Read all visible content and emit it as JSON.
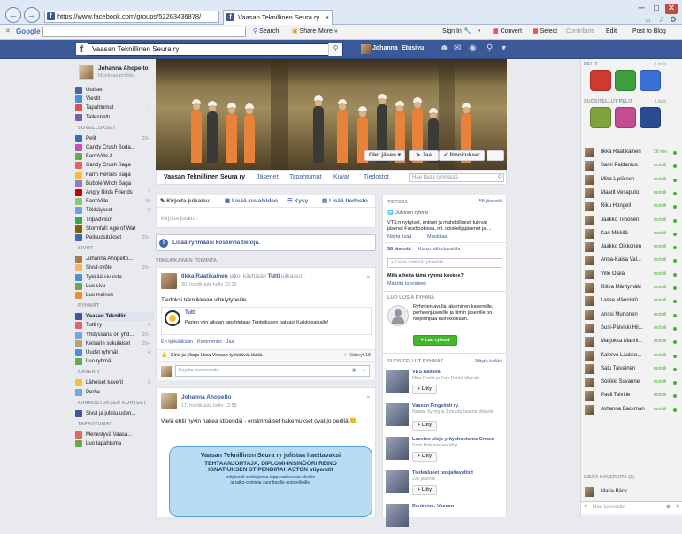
{
  "browser": {
    "url": "https://www.facebook.com/groups/52263436878/",
    "tab_title": "Vaasan Teknillinen Seura ry",
    "tab_close": "×",
    "window_buttons": [
      "─",
      "□",
      "✕"
    ]
  },
  "google_toolbar": {
    "close": "✕",
    "logo": "Google",
    "search_label": "Search",
    "share_label": "Share",
    "more_label": "More »",
    "signin_label": "Sign In",
    "convert_label": "Convert",
    "select_label": "Select",
    "contribute_label": "Contribute",
    "edit_label": "Edit",
    "post_label": "Post to Blog"
  },
  "fb_header": {
    "search_value": "Vaasan Teknillinen Seura ry",
    "user_name": "Johanna",
    "home_label": "Etusivu"
  },
  "left": {
    "profile_name": "Johanna Ahopelto",
    "profile_edit": "Muokkaa profiilia",
    "top_items": [
      {
        "label": "Uutiset",
        "count": "",
        "color": "#4267b2"
      },
      {
        "label": "Viestit",
        "count": "",
        "color": "#4a90d9"
      },
      {
        "label": "Tapahtumat",
        "count": "1",
        "color": "#d9534f"
      },
      {
        "label": "Tallennettu",
        "count": "",
        "color": "#7b5ea7"
      }
    ],
    "apps_title": "SOVELLUKSET",
    "apps": [
      {
        "label": "Pelit",
        "count": "20+",
        "color": "#2f6fbd"
      },
      {
        "label": "Candy Crush Soda...",
        "count": "",
        "color": "#c94bbd"
      },
      {
        "label": "FarmVille 2",
        "count": "",
        "color": "#6aa84f"
      },
      {
        "label": "Candy Crush Saga",
        "count": "",
        "color": "#e06666"
      },
      {
        "label": "Farm Heroes Saga",
        "count": "",
        "color": "#f1c232"
      },
      {
        "label": "Bubble Witch Saga",
        "count": "",
        "color": "#8e7cc3"
      },
      {
        "label": "Angry Birds Friends",
        "count": "7",
        "color": "#cc0000"
      },
      {
        "label": "FarmVille",
        "count": "16",
        "color": "#93c47d"
      },
      {
        "label": "Tökkäykset",
        "count": "2",
        "color": "#6d9eeb"
      },
      {
        "label": "TripAdvisor",
        "count": "",
        "color": "#34a853"
      },
      {
        "label": "Stormfall: Age of War",
        "count": "",
        "color": "#7f6000"
      },
      {
        "label": "Pelisuositukset",
        "count": "20+",
        "color": "#4267b2"
      }
    ],
    "pages_title": "SIVUT",
    "pages": [
      {
        "label": "Johanna Ahopelto...",
        "count": "",
        "color": "#a67c52"
      },
      {
        "label": "Sivut-syöte",
        "count": "20+",
        "color": "#f6b26b"
      },
      {
        "label": "Tykkää sivuista",
        "count": "",
        "color": "#4a90d9"
      },
      {
        "label": "Luo sivu",
        "count": "",
        "color": "#6aa84f"
      },
      {
        "label": "Luo mainos",
        "count": "",
        "color": "#e69138"
      }
    ],
    "groups_title": "RYHMÄT",
    "groups": [
      {
        "label": "Vaasan Teknillin...",
        "count": "",
        "color": "#3b5998"
      },
      {
        "label": "Tutti ry",
        "count": "4",
        "color": "#e06666"
      },
      {
        "label": "Yhdyssana on yhd...",
        "count": "20+",
        "color": "#6fa8dc"
      },
      {
        "label": "Keisarin sukulaiset",
        "count": "20+",
        "color": "#b6a36f"
      },
      {
        "label": "Uudet ryhmät",
        "count": "4",
        "color": "#4a90d9"
      },
      {
        "label": "Luo ryhmä",
        "count": "",
        "color": "#6aa84f"
      }
    ],
    "friends_title": "KAVERIT",
    "friends": [
      {
        "label": "Läheiset kaverit",
        "count": "3",
        "color": "#f1c232"
      },
      {
        "label": "Perhe",
        "count": "",
        "color": "#6fa8dc"
      }
    ],
    "interests_title": "KIINNOSTUKSEN KOHTEET",
    "interests": [
      {
        "label": "Sivut ja julkisuuden...",
        "count": "",
        "color": "#3b5998"
      }
    ],
    "events_title": "TAPAHTUMAT",
    "events": [
      {
        "label": "Menestyvä Vaasa...",
        "count": "",
        "color": "#e06666"
      },
      {
        "label": "Luo tapahtuma",
        "count": "",
        "color": "#6aa84f"
      }
    ]
  },
  "cover": {
    "joined_btn": "Olet jäsen",
    "share_btn": "Jaa",
    "notif_btn": "Ilmoitukset",
    "more_btn": "..."
  },
  "group_nav": {
    "name": "Vaasan Teknillinen Seura ry",
    "members": "Jäsenet",
    "events": "Tapahtumat",
    "photos": "Kuvat",
    "files": "Tiedostot",
    "search_placeholder": "Hae tästä ryhmästä"
  },
  "composer": {
    "write_tab": "Kirjoita julkaisu",
    "photo_tab": "Lisää kuva/video",
    "poll_tab": "Kysy",
    "file_tab": "Lisää tiedosto",
    "placeholder": "Kirjoita jotain..."
  },
  "info_banner": "Lisää ryhmääsi koskevia tietoja.",
  "recent_title": "VIIMEAIKAINEN TOIMINTA",
  "post1": {
    "author": "Ilkka Raatikainen",
    "via": "jakoi käyttäjän",
    "via_target": "Tutti",
    "via_suffix": "julkaisun.",
    "time": "30. huhtikuuta kello 22:30",
    "text": "Tiedoksi tekniikkaan vihkiytyneille...",
    "shared_author": "Tutti",
    "shared_text": "Parien yön aikaan tapahtetaan Tepteikusen patsas! Kaikki paikalle!",
    "actions": "En tykkääkään · Kommentoi · Jaa",
    "likes": "Sinä ja Marja-Liisa Vessan tykkäävät tästä.",
    "seen": "✓ Nähnyt 18",
    "comment_placeholder": "Kirjoita kommentti..."
  },
  "post2": {
    "author": "Johanna Ahopelto",
    "time": "17. huhtikuuta kello 12:58",
    "text": "Vielä ehtii hyvin hakea stipendiä - ensimmäiset hakemukset ovat jo perillä 🙂",
    "poster_line1": "Vaasan Teknillinen Seura ry julistaa haettavaksi",
    "poster_line2": "TEHTAANJOHTAJA, DIPLOMI-INSINÖÖRI REINO",
    "poster_line3": "IGNATIUKSEN STIPENDIRAHASTON stipendit",
    "poster_line4": "erityisesti opintojensa loppuvaiheessa oleville",
    "poster_line5": "ja jatko-opintoja suorittaville opiskelijoille."
  },
  "sidebar": {
    "info_title": "TIETOJA",
    "members_link": "58 jäsentä",
    "privacy": "Julkinen ryhmä",
    "description": "VTS:n nykyiset, entiset ja mahdollisesti tulevat jäsenet Facebookissa, ml. opiskelijajäsenet ja ...",
    "show_more": "Näytä lisää",
    "muokkaa": "Muokkaa",
    "members_count": "58 jäsentä",
    "invite_email": "Kutsu sähköpostilla",
    "add_member_placeholder": "+ Lisää ihmisiä ryhmään",
    "tags_title": "Mitä aiheita tämä ryhmä koskee?",
    "tags_link": "Määritä tunnisteet",
    "create_title": "LUO UUSIA RYHMIÄ",
    "create_text": "Ryhmien avulla jakaminen kavereille, perheenjäsenille ja tiimin jäsenille on helpompaa kuin koskaan.",
    "create_btn": "+ Luo ryhmä",
    "suggested_title": "SUOSITELLUT RYHMÄT",
    "see_all": "Näytä kaikki",
    "suggested": [
      {
        "name": "VES Aallava",
        "desc": "Mika Pietilä ja Turo Rantä liittyivät",
        "btn": "+ Liity"
      },
      {
        "name": "Vaasan Pingviinit ry.",
        "desc": "Natalia Syring ja 2 muuta kaveria liittyivät",
        "btn": "+ Liity"
      },
      {
        "name": "Laovien aloja yrityshautomo Crewe",
        "desc": "Sami Heikkinenen liittyi",
        "btn": "+ Liity"
      },
      {
        "name": "Tiedealueet poujaltavaltiot",
        "desc": "220 jäsentä",
        "btn": "+ Liity"
      },
      {
        "name": "Puukkoo - Vaasan",
        "desc": "",
        "btn": ""
      }
    ]
  },
  "right": {
    "games_title": "PELIT",
    "games_more": "Lisää",
    "suggested_games_title": "SUOSITELLUT PELIT",
    "suggested_games_more": "Lisää",
    "games": [
      "#d03a2e",
      "#3e9e3b",
      "#3a6fd3",
      "#7ea33a",
      "#c34d91",
      "#2b4c93"
    ],
    "chat_title": "LISÄÄ KAVEREITA (3)",
    "chat_search": "Hae",
    "chat_search_placeholder": "Hae kavereita",
    "contacts": [
      {
        "name": "Ilkka Raatikainen",
        "status": "26 min"
      },
      {
        "name": "Sami Paldanius",
        "status": "mobiili"
      },
      {
        "name": "Mika Lipiäinen",
        "status": "mobiili"
      },
      {
        "name": "Maarit Vesaputo",
        "status": "mobiili"
      },
      {
        "name": "Riku Hongell",
        "status": "mobiili"
      },
      {
        "name": "Jaakko Tiihonen",
        "status": "mobiili"
      },
      {
        "name": "Kari Mikkilä",
        "status": "mobiili"
      },
      {
        "name": "Jaakko Oikkonen",
        "status": "mobiili"
      },
      {
        "name": "Anna-Kaisa Val...",
        "status": "mobiili"
      },
      {
        "name": "Ville Ojala",
        "status": "mobiili"
      },
      {
        "name": "Riitva Mäntymäki",
        "status": "mobiili"
      },
      {
        "name": "Lasse Männistö",
        "status": "mobiili"
      },
      {
        "name": "Anssi Murtonen",
        "status": "mobiili"
      },
      {
        "name": "Susi-Päivikki Hil...",
        "status": "mobiili"
      },
      {
        "name": "Marjukka Manni...",
        "status": "mobiili"
      },
      {
        "name": "Kalervo Laakso...",
        "status": "mobiili"
      },
      {
        "name": "Satu Taivainen",
        "status": "mobiili"
      },
      {
        "name": "Soilikki Suvanne",
        "status": "mobiili"
      },
      {
        "name": "Pauli Talvitie",
        "status": "mobiili"
      },
      {
        "name": "Johanna Backman",
        "status": "mobiili"
      }
    ],
    "more_friends_title": "LISÄÄ KAVEREITA (3)",
    "more_contacts": [
      {
        "name": "Maria Bäck",
        "status": ""
      }
    ]
  }
}
